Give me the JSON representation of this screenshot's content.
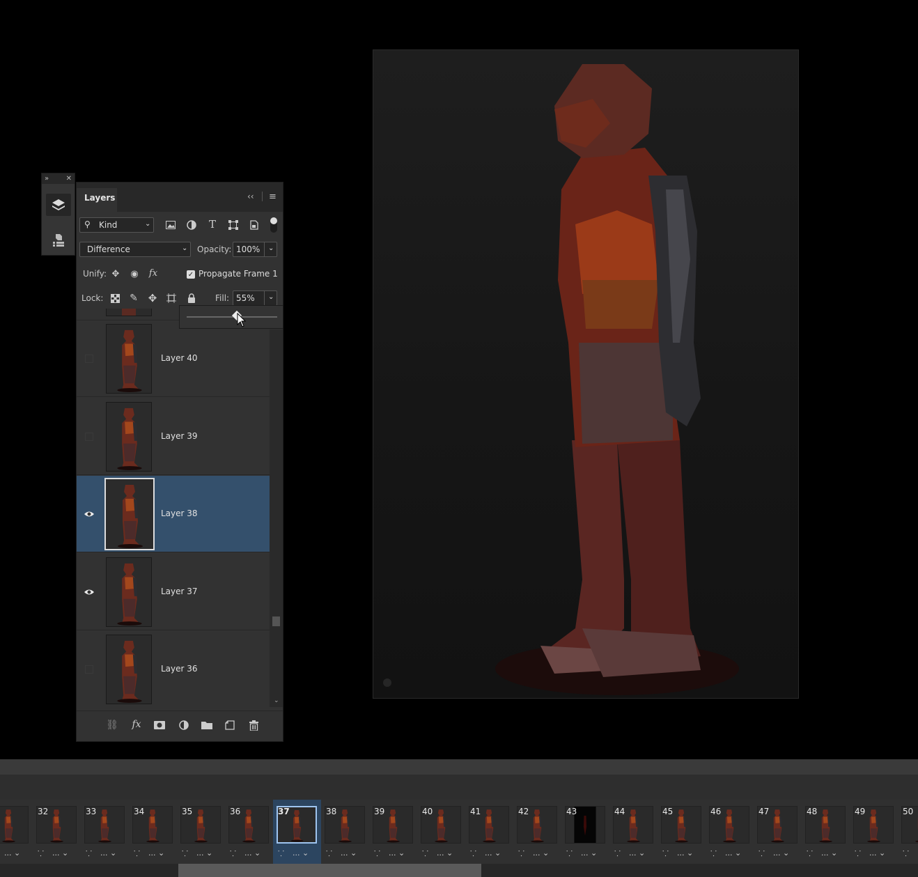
{
  "dock": {
    "layers_icon": "layers-stack-icon",
    "three_d_icon": "3d-cube-icon"
  },
  "panel": {
    "tab_label": "Layers",
    "filter": {
      "icon": "search-icon",
      "value": "Kind"
    },
    "blend_mode": "Difference",
    "opacity_label": "Opacity:",
    "opacity_value": "100%",
    "unify_label": "Unify:",
    "propagate_label": "Propagate Frame 1",
    "propagate_checked": true,
    "lock_label": "Lock:",
    "fill_label": "Fill:",
    "fill_value": "55%",
    "fill_slider_fraction": 0.55,
    "layers": [
      {
        "name": "Layer 40",
        "visible": false,
        "selected": false
      },
      {
        "name": "Layer 39",
        "visible": false,
        "selected": false
      },
      {
        "name": "Layer 38",
        "visible": true,
        "selected": true
      },
      {
        "name": "Layer 37",
        "visible": true,
        "selected": false
      },
      {
        "name": "Layer 36",
        "visible": false,
        "selected": false
      }
    ]
  },
  "timeline": {
    "frames": [
      {
        "num": "",
        "delay": "..."
      },
      {
        "num": "32",
        "delay": "..."
      },
      {
        "num": "33",
        "delay": "..."
      },
      {
        "num": "34",
        "delay": "..."
      },
      {
        "num": "35",
        "delay": "..."
      },
      {
        "num": "36",
        "delay": "..."
      },
      {
        "num": "37",
        "delay": "...",
        "selected": true
      },
      {
        "num": "38",
        "delay": "..."
      },
      {
        "num": "39",
        "delay": "..."
      },
      {
        "num": "40",
        "delay": "..."
      },
      {
        "num": "41",
        "delay": "..."
      },
      {
        "num": "42",
        "delay": "..."
      },
      {
        "num": "43",
        "delay": "...",
        "dark": true
      },
      {
        "num": "44",
        "delay": "..."
      },
      {
        "num": "45",
        "delay": "..."
      },
      {
        "num": "46",
        "delay": "..."
      },
      {
        "num": "47",
        "delay": "..."
      },
      {
        "num": "48",
        "delay": "..."
      },
      {
        "num": "49",
        "delay": "..."
      },
      {
        "num": "50",
        "delay": ""
      }
    ]
  }
}
